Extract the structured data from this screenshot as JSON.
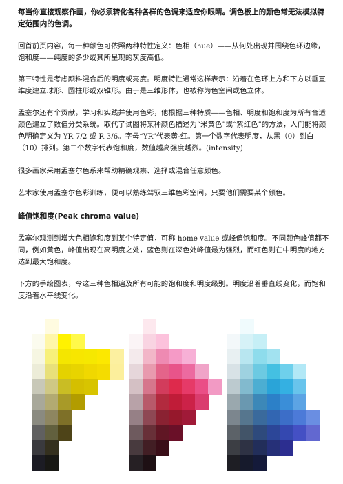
{
  "intro": "每当你直接观察作画，你必须转化各种各样的色调来适应你眼睛。调色板上的颜色常无法模拟特定范围内的色调。",
  "p1": "回首前页内容，每一种颜色可依照两种特性定义：色相（hue）——从何处出现并围绕色环边缘，饱和度——纯度的多少或其所呈现的灰度高低。",
  "p2": "第三特性是考虑颜料混合后的明度或亮度。明度特性通常这样表示：沿着在色环上方和下方以垂直维度建立球形、圆柱形或双锥形。由于是三维形体，也被称为色空间或色立体。",
  "p3": "孟塞尔还有个贡献，学习和实践并使用色彩，他根据三种特质——色相、明度和饱和度为所有合适颜色建立了数值分类系统。取代了试图将某种颜色描述为“米黄色”或“紫红色”的方法，人们能将颜色明确定义为 YR 7/2 或 R 3/6。字母“YR”代表黄-红。第一个数字代表明度，从黑（0）到白（10）排列。第二个数字代表饱和度，数值越高强度越烈。(intensity)",
  "p4": "很多画家采用孟塞尔色系来帮助精确观察、选择或混合任意颜色。",
  "p5": "艺术家使用孟塞尔色彩训练，便可以熟练驾驭三维色彩空间，只要他们需要某个颜色。",
  "heading": "峰值饱和度(Peak chroma value)",
  "p6": "孟塞尔观测到增大色相饱和度到某个特定值，可称 home value 或峰值饱和度。不同颜色峰值都不同，例如黄色，峰值出现在高明度之处，蓝色则在深色处峰值最为强烈，而红色则在中明度的地方达到最大饱和度。",
  "p7": "下方的手绘图表，令这三种色相遍及所有可能的饱和度和明度级别。明度沿着垂直线变化，而饱和度沿着水平线变化。",
  "swatches": [
    {
      "name": "yellow",
      "rows": [
        [
          "#ffffff",
          "#fffbe0"
        ],
        [
          "#fbfbee",
          "#fff6a8",
          "#fff200",
          "#fff94a"
        ],
        [
          "#f6f6e2",
          "#f7f07a",
          "#f4e600",
          "#f7e600",
          "#f6e800",
          "#fce800",
          "#fcf0a0"
        ],
        [
          "#ececd8",
          "#e8e07a",
          "#e4d200",
          "#e8d400",
          "#f0d800",
          "#f4dc00",
          "#fcef9c"
        ],
        [
          "#c8c8b8",
          "#cfc884",
          "#c9bd24",
          "#d5bf00",
          "#d8c400"
        ],
        [
          "#a8a89a",
          "#b2aa72",
          "#a89a28",
          "#b29c00"
        ],
        [
          "#8a8a80",
          "#8e8660",
          "#7e7028"
        ],
        [
          "#606060",
          "#62603e",
          "#4e4418"
        ],
        [
          "#3a3a3e",
          "#34301e"
        ],
        [
          "#1c1c24",
          "#181814"
        ]
      ]
    },
    {
      "name": "red",
      "rows": [
        [
          "#ffffff",
          "#fde8ee"
        ],
        [
          "#fbf4f6",
          "#f9d4e2",
          "#fcc2dc"
        ],
        [
          "#f4eaec",
          "#f2b6c8",
          "#ee8ab2",
          "#f59ac6",
          "#f7b0d6"
        ],
        [
          "#e6d6da",
          "#e89aae",
          "#e4648a",
          "#e8548a",
          "#ec6aa0",
          "#f0a4c8"
        ],
        [
          "#d4c0c4",
          "#d6768c",
          "#d23c5c",
          "#de2a4c",
          "#e63a68",
          "#ea4e86",
          "#f29ac4"
        ],
        [
          "#b8a2a8",
          "#b85a6a",
          "#b22a3e",
          "#c01c38",
          "#cc2248",
          "#da3c6e"
        ],
        [
          "#968086",
          "#8e4854",
          "#8a2232",
          "#96182c",
          "#a01a38"
        ],
        [
          "#6e5a5e",
          "#683038",
          "#601624",
          "#6a1028"
        ],
        [
          "#483a3e",
          "#421e24",
          "#3a0e18"
        ],
        [
          "#262024",
          "#1e1014"
        ]
      ]
    },
    {
      "name": "blue",
      "rows": [
        [
          "#ffffff",
          "#f0fbfd"
        ],
        [
          "#f3f8fa",
          "#d6f2f7",
          "#c6eff6"
        ],
        [
          "#e8f0f2",
          "#b8e6f0",
          "#8edcec",
          "#a2e2f0"
        ],
        [
          "#d8e2e6",
          "#9ed2e0",
          "#6ccae2",
          "#44c0e2",
          "#6ed0ec",
          "#b2e8f6"
        ],
        [
          "#bccacf",
          "#82bace",
          "#4caed2",
          "#2aa4d8",
          "#34b0e2",
          "#68c4ec"
        ],
        [
          "#9aa8ae",
          "#6a98b0",
          "#3c88b8",
          "#2c80c8",
          "#3a8ed8",
          "#5ca4e4"
        ],
        [
          "#7c868e",
          "#56768e",
          "#3a6a9c",
          "#3266b2",
          "#3c6ec8",
          "#4c7ad8",
          "#6a8ee2"
        ],
        [
          "#5c6268",
          "#425468",
          "#2e4a7c",
          "#2c4698",
          "#3448b0",
          "#4450c4",
          "#6268d0"
        ],
        [
          "#3c3e44",
          "#2e3244",
          "#222e5a",
          "#263078",
          "#2c2e90"
        ],
        [
          "#1e1e24",
          "#161a2c",
          "#141a3a"
        ]
      ]
    }
  ]
}
